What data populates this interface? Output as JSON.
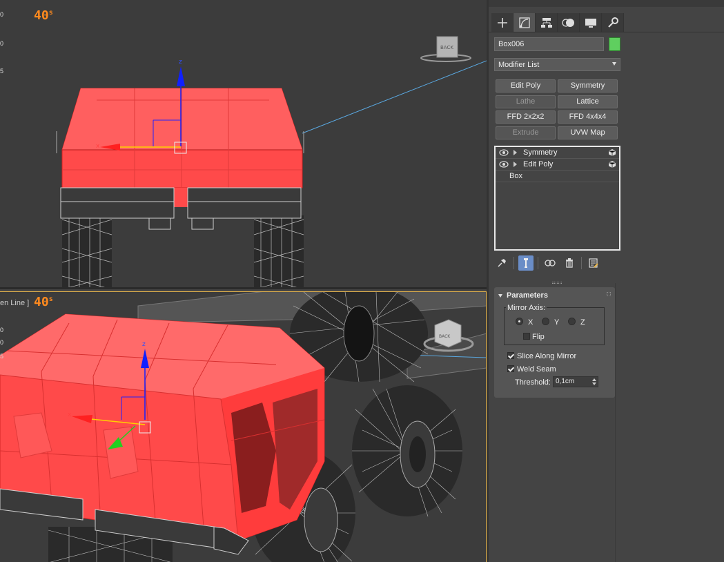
{
  "viewports": {
    "top": {
      "fps": "40",
      "fps_unit": "s",
      "ruler": [
        "0",
        "0",
        "5"
      ]
    },
    "bottom": {
      "fps": "40",
      "fps_unit": "s",
      "label_fragment": "en Line ]",
      "ruler": [
        "0",
        "0",
        "5"
      ]
    }
  },
  "viewcube": {
    "top_face": "BACK",
    "bottom_face": "BACK"
  },
  "gizmo": {
    "z_label": "z",
    "x_label": "x"
  },
  "panel": {
    "tabs": [
      "create-icon",
      "modify-icon",
      "hierarchy-icon",
      "motion-icon",
      "display-icon",
      "utilities-icon"
    ],
    "object_name": "Box006",
    "object_color": "#5fcf5f",
    "modifier_list": "Modifier List",
    "modifier_buttons": [
      {
        "label": "Edit Poly",
        "enabled": true
      },
      {
        "label": "Symmetry",
        "enabled": true
      },
      {
        "label": "Lathe",
        "enabled": false
      },
      {
        "label": "Lattice",
        "enabled": true
      },
      {
        "label": "FFD 2x2x2",
        "enabled": true
      },
      {
        "label": "FFD 4x4x4",
        "enabled": true
      },
      {
        "label": "Extrude",
        "enabled": false
      },
      {
        "label": "UVW Map",
        "enabled": true
      }
    ],
    "stack": [
      {
        "label": "Symmetry"
      },
      {
        "label": "Edit Poly"
      },
      {
        "label": "Box"
      }
    ],
    "parameters": {
      "title": "Parameters",
      "mirror_axis_label": "Mirror Axis:",
      "axes": [
        "X",
        "Y",
        "Z"
      ],
      "selected_axis": "X",
      "flip_label": "Flip",
      "flip": false,
      "slice_label": "Slice Along Mirror",
      "slice": true,
      "weld_label": "Weld Seam",
      "weld": true,
      "threshold_label": "Threshold:",
      "threshold_value": "0,1cm"
    }
  },
  "colors": {
    "accent": "#e9b64b",
    "selection": "#ff4040",
    "panel_bg": "#444444"
  }
}
